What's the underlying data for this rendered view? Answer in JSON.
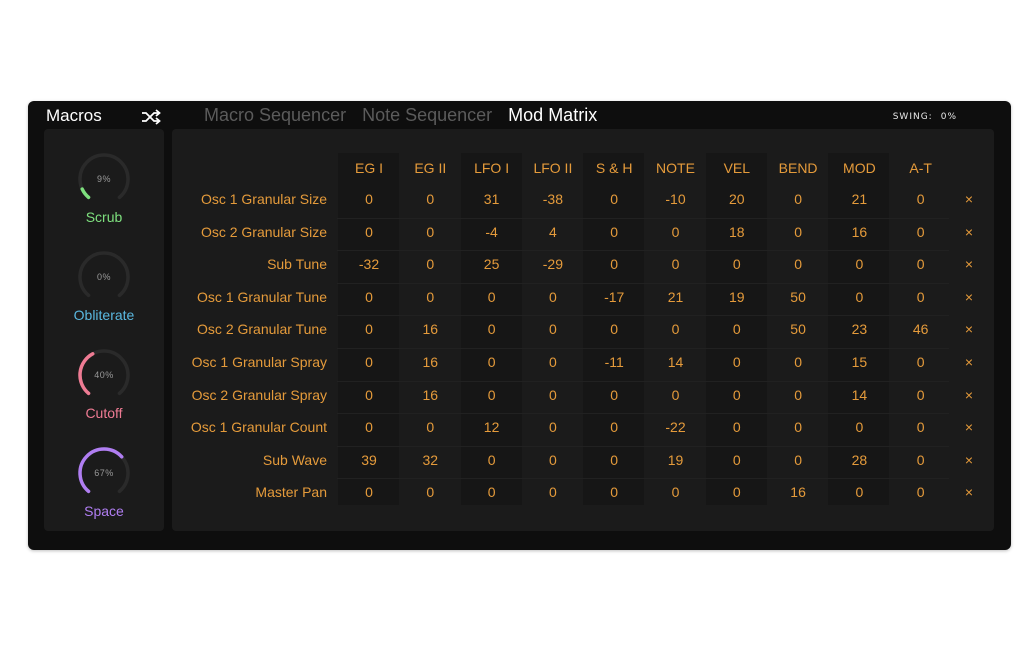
{
  "header": {
    "title": "Macros",
    "shuffle_icon": "shuffle-icon",
    "tabs": [
      "Macro Sequencer",
      "Note Sequencer",
      "Mod Matrix"
    ],
    "active_tab": "Mod Matrix",
    "swing_label": "SWING:",
    "swing_value": "0%"
  },
  "macros": [
    {
      "name": "Scrub",
      "value": "9%",
      "fraction": 0.09,
      "color": "#7ee07e"
    },
    {
      "name": "Obliterate",
      "value": "0%",
      "fraction": 0.0,
      "color": "#5ab8e0"
    },
    {
      "name": "Cutoff",
      "value": "40%",
      "fraction": 0.4,
      "color": "#ee7b93"
    },
    {
      "name": "Space",
      "value": "67%",
      "fraction": 0.67,
      "color": "#b07ef2"
    }
  ],
  "matrix": {
    "columns": [
      "EG I",
      "EG II",
      "LFO I",
      "LFO II",
      "S & H",
      "NOTE",
      "VEL",
      "BEND",
      "MOD",
      "A-T"
    ],
    "rows": [
      {
        "label": "Osc 1 Granular Size",
        "values": [
          "0",
          "0",
          "31",
          "-38",
          "0",
          "-10",
          "20",
          "0",
          "21",
          "0"
        ]
      },
      {
        "label": "Osc 2 Granular Size",
        "values": [
          "0",
          "0",
          "-4",
          "4",
          "0",
          "0",
          "18",
          "0",
          "16",
          "0"
        ]
      },
      {
        "label": "Sub Tune",
        "values": [
          "-32",
          "0",
          "25",
          "-29",
          "0",
          "0",
          "0",
          "0",
          "0",
          "0"
        ]
      },
      {
        "label": "Osc 1 Granular Tune",
        "values": [
          "0",
          "0",
          "0",
          "0",
          "-17",
          "21",
          "19",
          "50",
          "0",
          "0"
        ]
      },
      {
        "label": "Osc 2 Granular Tune",
        "values": [
          "0",
          "16",
          "0",
          "0",
          "0",
          "0",
          "0",
          "50",
          "23",
          "46"
        ]
      },
      {
        "label": "Osc 1 Granular Spray",
        "values": [
          "0",
          "16",
          "0",
          "0",
          "-11",
          "14",
          "0",
          "0",
          "15",
          "0"
        ]
      },
      {
        "label": "Osc 2 Granular Spray",
        "values": [
          "0",
          "16",
          "0",
          "0",
          "0",
          "0",
          "0",
          "0",
          "14",
          "0"
        ]
      },
      {
        "label": "Osc 1 Granular Count",
        "values": [
          "0",
          "0",
          "12",
          "0",
          "0",
          "-22",
          "0",
          "0",
          "0",
          "0"
        ]
      },
      {
        "label": "Sub Wave",
        "values": [
          "39",
          "32",
          "0",
          "0",
          "0",
          "19",
          "0",
          "0",
          "28",
          "0"
        ]
      },
      {
        "label": "Master Pan",
        "values": [
          "0",
          "0",
          "0",
          "0",
          "0",
          "0",
          "0",
          "16",
          "0",
          "0"
        ]
      }
    ],
    "delete_glyph": "×",
    "accent_color": "#e59b3b"
  }
}
